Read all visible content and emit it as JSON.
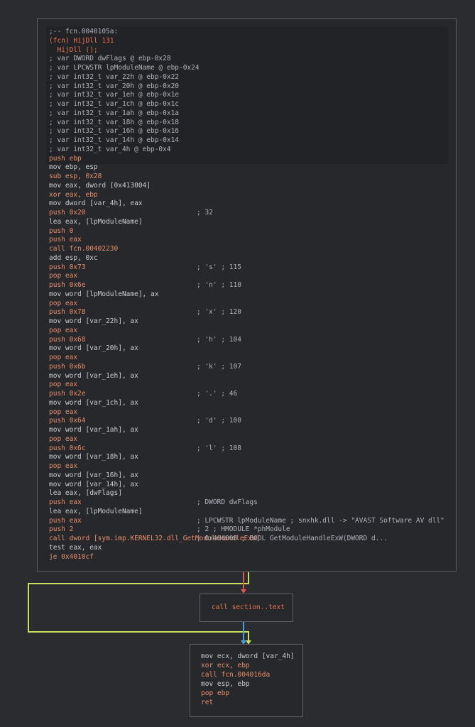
{
  "main_node": {
    "header": [
      ";-- fcn.0040105a:",
      "(fcn) HijDll 131",
      "  HijDll ();",
      "; var DWORD dwFlags @ ebp-0x28",
      "; var LPCWSTR lpModuleName @ ebp-0x24",
      "; var int32_t var_22h @ ebp-0x22",
      "; var int32_t var_20h @ ebp-0x20",
      "; var int32_t var_1eh @ ebp-0x1e",
      "; var int32_t var_1ch @ ebp-0x1c",
      "; var int32_t var_1ah @ ebp-0x1a",
      "; var int32_t var_18h @ ebp-0x18",
      "; var int32_t var_16h @ ebp-0x16",
      "; var int32_t var_14h @ ebp-0x14",
      "; var int32_t var_4h @ ebp-0x4"
    ],
    "instructions": [
      {
        "text": "push ebp",
        "comment": ""
      },
      {
        "text": "mov ebp, esp",
        "comment": ""
      },
      {
        "text": "sub esp, 0x28",
        "comment": ""
      },
      {
        "text": "mov eax, dword [0x413004]",
        "comment": ""
      },
      {
        "text": "xor eax, ebp",
        "comment": ""
      },
      {
        "text": "mov dword [var_4h], eax",
        "comment": ""
      },
      {
        "text": "push 0x20",
        "comment": "; 32"
      },
      {
        "text": "lea eax, [lpModuleName]",
        "comment": ""
      },
      {
        "text": "push 0",
        "comment": ""
      },
      {
        "text": "push eax",
        "comment": ""
      },
      {
        "text": "call fcn.00402230",
        "comment": ""
      },
      {
        "text": "add esp, 0xc",
        "comment": ""
      },
      {
        "text": "push 0x73",
        "comment": "; 's' ; 115"
      },
      {
        "text": "pop eax",
        "comment": ""
      },
      {
        "text": "push 0x6e",
        "comment": "; 'n' ; 110"
      },
      {
        "text": "mov word [lpModuleName], ax",
        "comment": ""
      },
      {
        "text": "pop eax",
        "comment": ""
      },
      {
        "text": "push 0x78",
        "comment": "; 'x' ; 120"
      },
      {
        "text": "mov word [var_22h], ax",
        "comment": ""
      },
      {
        "text": "pop eax",
        "comment": ""
      },
      {
        "text": "push 0x68",
        "comment": "; 'h' ; 104"
      },
      {
        "text": "mov word [var_20h], ax",
        "comment": ""
      },
      {
        "text": "pop eax",
        "comment": ""
      },
      {
        "text": "push 0x6b",
        "comment": "; 'k' ; 107"
      },
      {
        "text": "mov word [var_1eh], ax",
        "comment": ""
      },
      {
        "text": "pop eax",
        "comment": ""
      },
      {
        "text": "push 0x2e",
        "comment": "; '.' ; 46"
      },
      {
        "text": "mov word [var_1ch], ax",
        "comment": ""
      },
      {
        "text": "pop eax",
        "comment": ""
      },
      {
        "text": "push 0x64",
        "comment": "; 'd' ; 100"
      },
      {
        "text": "mov word [var_1ah], ax",
        "comment": ""
      },
      {
        "text": "pop eax",
        "comment": ""
      },
      {
        "text": "push 0x6c",
        "comment": "; 'l' ; 108"
      },
      {
        "text": "mov word [var_18h], ax",
        "comment": ""
      },
      {
        "text": "pop eax",
        "comment": ""
      },
      {
        "text": "mov word [var_16h], ax",
        "comment": ""
      },
      {
        "text": "mov word [var_14h], ax",
        "comment": ""
      },
      {
        "text": "lea eax, [dwFlags]",
        "comment": ""
      },
      {
        "text": "push eax",
        "comment": "; DWORD dwFlags"
      },
      {
        "text": "lea eax, [lpModuleName]",
        "comment": ""
      },
      {
        "text": "push eax",
        "comment": "; LPCWSTR lpModuleName ; snxhk.dll -> \"AVAST Software AV dll\""
      },
      {
        "text": "push 2",
        "comment": "; 2 ; HMODULE *phModule"
      },
      {
        "text": "call dword [sym.imp.KERNEL32.dll_GetModuleHandleExW]",
        "comment": "; 0x40d000 ; BOOL GetModuleHandleExW(DWORD d..."
      },
      {
        "text": "test eax, eax",
        "comment": ""
      },
      {
        "text": "je 0x4010cf",
        "comment": ""
      }
    ]
  },
  "mid_node": {
    "text": "call section..text"
  },
  "bot_node": {
    "instructions": [
      "mov ecx, dword [var_4h]",
      "xor ecx, ebp",
      "call fcn.004016da",
      "mov esp, ebp",
      "pop ebp",
      "ret"
    ]
  },
  "colors": {
    "background": "#2a2c30",
    "edge_true": "#c8e05a",
    "edge_false": "#e55454",
    "edge_uncond": "#4aa3d8"
  }
}
